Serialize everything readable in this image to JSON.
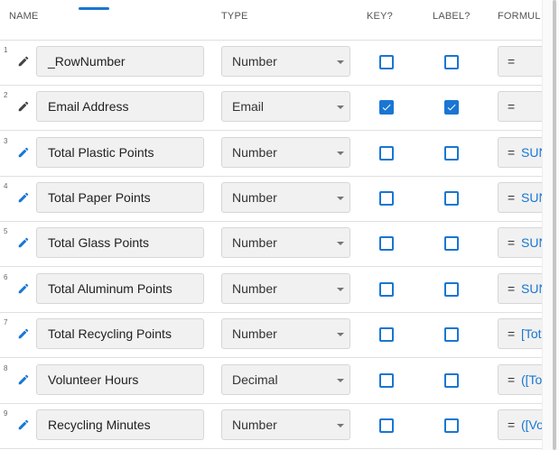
{
  "columns": {
    "name": "NAME",
    "type": "TYPE",
    "key": "KEY?",
    "label": "LABEL?",
    "formula": "FORMUL"
  },
  "accent_color": "#1976d2",
  "rows": [
    {
      "num": "1",
      "name": "_RowNumber",
      "type": "Number",
      "key": false,
      "label": false,
      "eq": "=",
      "formula": "",
      "icon": "pencil-icon-gray"
    },
    {
      "num": "2",
      "name": "Email Address",
      "type": "Email",
      "key": true,
      "label": true,
      "eq": "=",
      "formula": "",
      "icon": "pencil-icon-gray"
    },
    {
      "num": "3",
      "name": "Total Plastic Points",
      "type": "Number",
      "key": false,
      "label": false,
      "eq": "=",
      "formula": "SUN",
      "icon": "pencil-icon-blue"
    },
    {
      "num": "4",
      "name": "Total Paper Points",
      "type": "Number",
      "key": false,
      "label": false,
      "eq": "=",
      "formula": "SUN",
      "icon": "pencil-icon-blue"
    },
    {
      "num": "5",
      "name": "Total Glass Points",
      "type": "Number",
      "key": false,
      "label": false,
      "eq": "=",
      "formula": "SUN",
      "icon": "pencil-icon-blue"
    },
    {
      "num": "6",
      "name": "Total Aluminum Points",
      "type": "Number",
      "key": false,
      "label": false,
      "eq": "=",
      "formula": "SUN",
      "icon": "pencil-icon-blue"
    },
    {
      "num": "7",
      "name": "Total Recycling Points",
      "type": "Number",
      "key": false,
      "label": false,
      "eq": "=",
      "formula": "[Tot",
      "icon": "pencil-icon-blue"
    },
    {
      "num": "8",
      "name": "Volunteer Hours",
      "type": "Decimal",
      "key": false,
      "label": false,
      "eq": "=",
      "formula": "([To",
      "icon": "pencil-icon-blue"
    },
    {
      "num": "9",
      "name": "Recycling Minutes",
      "type": "Number",
      "key": false,
      "label": false,
      "eq": "=",
      "formula": "([Vo",
      "icon": "pencil-icon-blue"
    }
  ]
}
